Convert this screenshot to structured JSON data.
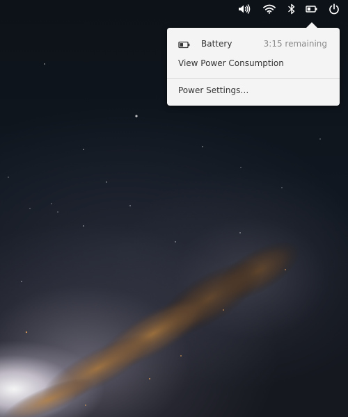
{
  "panel": {
    "indicators": [
      {
        "name": "sound",
        "icon": "volume-high-icon"
      },
      {
        "name": "network",
        "icon": "wifi-icon"
      },
      {
        "name": "bluetooth",
        "icon": "bluetooth-icon"
      },
      {
        "name": "power",
        "icon": "battery-icon"
      },
      {
        "name": "session",
        "icon": "power-icon"
      }
    ],
    "icon_color": "#ffffff"
  },
  "power_menu": {
    "battery": {
      "title": "Battery",
      "remaining": "3:15 remaining",
      "level": 0.45
    },
    "view_power_label": "View Power Consumption",
    "settings_label": "Power Settings…"
  },
  "colors": {
    "menu_background": "#f4f4f4",
    "menu_text": "#333333",
    "menu_secondary_text": "#8a8a8a",
    "divider": "#d6d6d6"
  }
}
